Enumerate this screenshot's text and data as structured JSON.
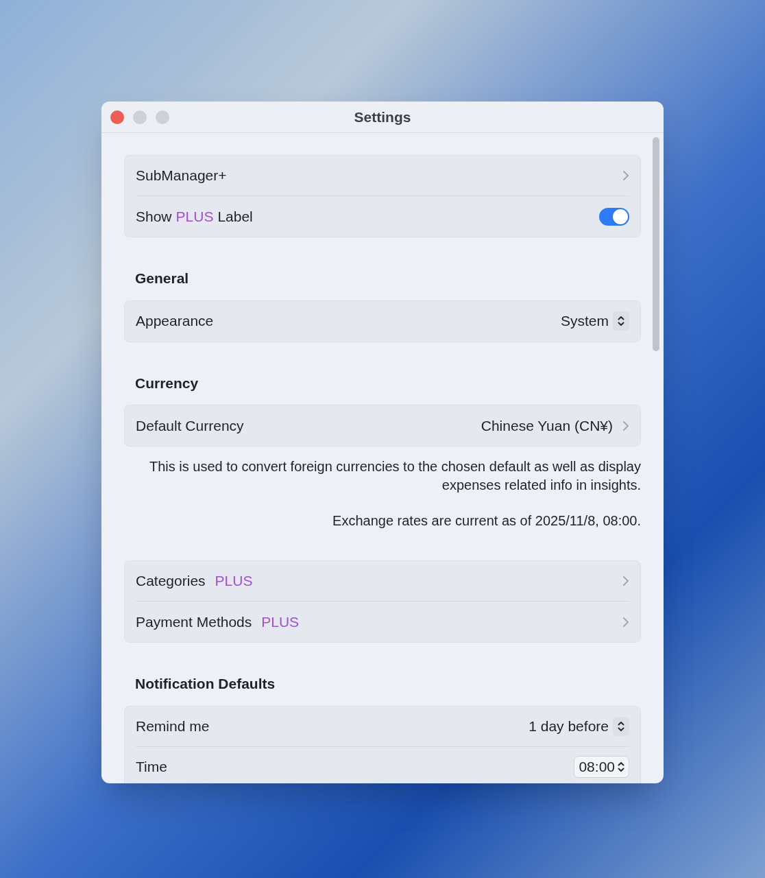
{
  "window": {
    "title": "Settings"
  },
  "sections": [
    {
      "rows": [
        {
          "kind": "link",
          "label": "SubManager+"
        },
        {
          "kind": "toggle",
          "label": "Show",
          "badge": "PLUS",
          "label_after": "Label",
          "on": true
        }
      ]
    },
    {
      "header": "General",
      "rows": [
        {
          "kind": "popup",
          "label": "Appearance",
          "value": "System"
        }
      ]
    },
    {
      "header": "Currency",
      "rows": [
        {
          "kind": "link",
          "label": "Default Currency",
          "value": "Chinese Yuan (CN¥)"
        }
      ],
      "notes": [
        "This is used to convert foreign currencies to the chosen default as well as display expenses related info in insights.",
        "Exchange rates are current as of 2025/11/8, 08:00."
      ]
    },
    {
      "rows": [
        {
          "kind": "link",
          "label": "Categories",
          "badge": "PLUS"
        },
        {
          "kind": "link",
          "label": "Payment Methods",
          "badge": "PLUS"
        }
      ]
    },
    {
      "header": "Notification Defaults",
      "rows": [
        {
          "kind": "popup",
          "label": "Remind me",
          "value": "1 day before"
        },
        {
          "kind": "time",
          "label": "Time",
          "value": "08:00"
        }
      ]
    }
  ]
}
